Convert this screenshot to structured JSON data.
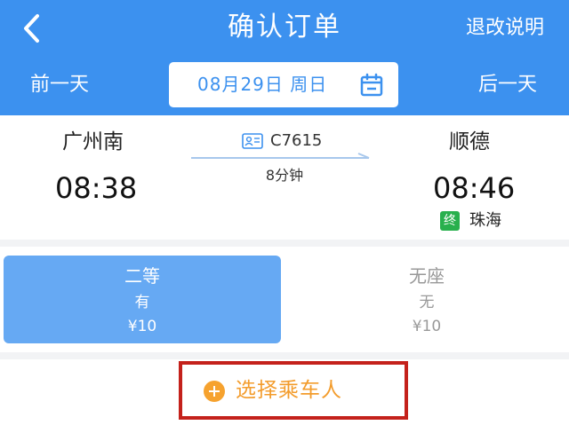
{
  "header": {
    "back_icon": "chevron-left-icon",
    "title": "确认订单",
    "refund_label": "退改说明",
    "prev_day": "前一天",
    "next_day": "后一天",
    "date": "08月29日 周日",
    "calendar_icon": "calendar-icon",
    "bg_color": "#3c91ef"
  },
  "trip": {
    "from_station": "广州南",
    "depart_time": "08:38",
    "train_icon": "id-card-icon",
    "train_number": "C7615",
    "duration": "8分钟",
    "to_station": "顺德",
    "arrive_time": "08:46",
    "terminal_badge": "终",
    "terminal_city": "珠海"
  },
  "seats": [
    {
      "name": "二等",
      "availability": "有",
      "price": "¥10",
      "selected": true
    },
    {
      "name": "无座",
      "availability": "无",
      "price": "¥10",
      "selected": false
    }
  ],
  "passenger": {
    "plus_icon": "plus-circle-icon",
    "label": "选择乘车人",
    "accent_color": "#f39c2c"
  }
}
